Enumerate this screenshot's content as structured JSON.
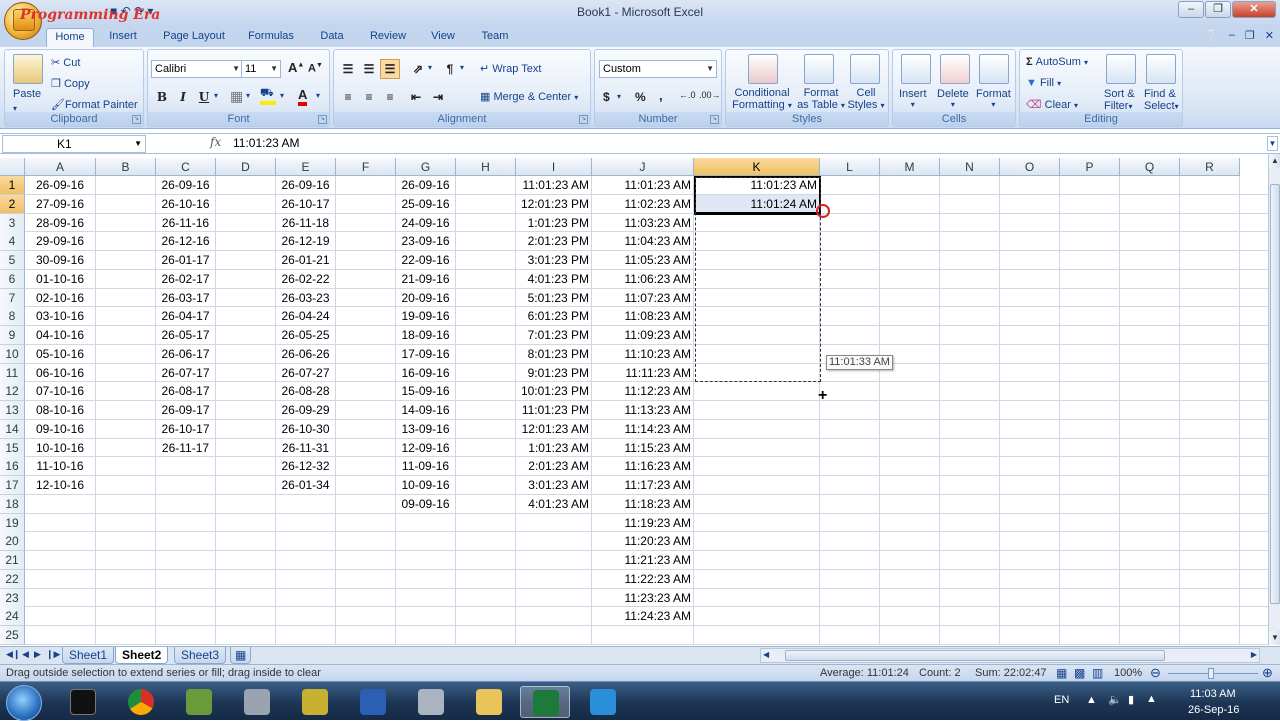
{
  "window": {
    "title": "Book1 - Microsoft Excel",
    "watermark": "Programming Era"
  },
  "tabs": [
    "Home",
    "Insert",
    "Page Layout",
    "Formulas",
    "Data",
    "Review",
    "View",
    "Team"
  ],
  "ribbon": {
    "clipboard": {
      "label": "Clipboard",
      "paste": "Paste",
      "cut": "Cut",
      "copy": "Copy",
      "format_painter": "Format Painter"
    },
    "font": {
      "label": "Font",
      "name": "Calibri",
      "size": "11"
    },
    "alignment": {
      "label": "Alignment",
      "wrap": "Wrap Text",
      "merge": "Merge & Center"
    },
    "number": {
      "label": "Number",
      "format": "Custom",
      "currency": "$",
      "percent": "%",
      "comma": ","
    },
    "styles": {
      "label": "Styles",
      "conditional": "Conditional",
      "conditional2": "Formatting",
      "format_table": "Format",
      "format_table2": "as Table",
      "cell_styles": "Cell",
      "cell_styles2": "Styles"
    },
    "cells": {
      "label": "Cells",
      "insert": "Insert",
      "delete": "Delete",
      "format": "Format"
    },
    "editing": {
      "label": "Editing",
      "autosum": "AutoSum",
      "fill": "Fill",
      "clear": "Clear",
      "sort": "Sort &",
      "sort2": "Filter",
      "find": "Find &",
      "find2": "Select"
    }
  },
  "formula_bar": {
    "name_box": "K1",
    "fx": "fx",
    "value": "11:01:23 AM"
  },
  "columns": [
    "A",
    "B",
    "C",
    "D",
    "E",
    "F",
    "G",
    "H",
    "I",
    "J",
    "K",
    "L",
    "M",
    "N",
    "O",
    "P",
    "Q",
    "R"
  ],
  "rows": [
    "1",
    "2",
    "3",
    "4",
    "5",
    "6",
    "7",
    "8",
    "9",
    "10",
    "11",
    "12",
    "13",
    "14",
    "15",
    "16",
    "17",
    "18",
    "19",
    "20",
    "21",
    "22",
    "23",
    "24",
    "25"
  ],
  "cells": {
    "A": [
      "26-09-16",
      "27-09-16",
      "28-09-16",
      "29-09-16",
      "30-09-16",
      "01-10-16",
      "02-10-16",
      "03-10-16",
      "04-10-16",
      "05-10-16",
      "06-10-16",
      "07-10-16",
      "08-10-16",
      "09-10-16",
      "10-10-16",
      "11-10-16",
      "12-10-16"
    ],
    "C": [
      "26-09-16",
      "26-10-16",
      "26-11-16",
      "26-12-16",
      "26-01-17",
      "26-02-17",
      "26-03-17",
      "26-04-17",
      "26-05-17",
      "26-06-17",
      "26-07-17",
      "26-08-17",
      "26-09-17",
      "26-10-17",
      "26-11-17"
    ],
    "E": [
      "26-09-16",
      "26-10-17",
      "26-11-18",
      "26-12-19",
      "26-01-21",
      "26-02-22",
      "26-03-23",
      "26-04-24",
      "26-05-25",
      "26-06-26",
      "26-07-27",
      "26-08-28",
      "26-09-29",
      "26-10-30",
      "26-11-31",
      "26-12-32",
      "26-01-34"
    ],
    "G": [
      "26-09-16",
      "25-09-16",
      "24-09-16",
      "23-09-16",
      "22-09-16",
      "21-09-16",
      "20-09-16",
      "19-09-16",
      "18-09-16",
      "17-09-16",
      "16-09-16",
      "15-09-16",
      "14-09-16",
      "13-09-16",
      "12-09-16",
      "11-09-16",
      "10-09-16",
      "09-09-16"
    ],
    "I": [
      "11:01:23 AM",
      "12:01:23 PM",
      "1:01:23 PM",
      "2:01:23 PM",
      "3:01:23 PM",
      "4:01:23 PM",
      "5:01:23 PM",
      "6:01:23 PM",
      "7:01:23 PM",
      "8:01:23 PM",
      "9:01:23 PM",
      "10:01:23 PM",
      "11:01:23 PM",
      "12:01:23 AM",
      "1:01:23 AM",
      "2:01:23 AM",
      "3:01:23 AM",
      "4:01:23 AM"
    ],
    "J": [
      "11:01:23 AM",
      "11:02:23 AM",
      "11:03:23 AM",
      "11:04:23 AM",
      "11:05:23 AM",
      "11:06:23 AM",
      "11:07:23 AM",
      "11:08:23 AM",
      "11:09:23 AM",
      "11:10:23 AM",
      "11:11:23 AM",
      "11:12:23 AM",
      "11:13:23 AM",
      "11:14:23 AM",
      "11:15:23 AM",
      "11:16:23 AM",
      "11:17:23 AM",
      "11:18:23 AM",
      "11:19:23 AM",
      "11:20:23 AM",
      "11:21:23 AM",
      "11:22:23 AM",
      "11:23:23 AM",
      "11:24:23 AM"
    ],
    "K": [
      "11:01:23 AM",
      "11:01:24 AM"
    ]
  },
  "fill_tooltip": "11:01:33 AM",
  "sheets": [
    "Sheet1",
    "Sheet2",
    "Sheet3"
  ],
  "active_sheet": "Sheet2",
  "status": {
    "message": "Drag outside selection to extend series or fill; drag inside to clear",
    "average": "Average: 11:01:24",
    "count": "Count: 2",
    "sum": "Sum: 22:02:47",
    "zoom": "100%"
  },
  "tray": {
    "lang": "EN",
    "time": "11:03 AM",
    "date": "26-Sep-16"
  },
  "colors": {
    "accent": "#15428b",
    "selected_header": "#f1c15f",
    "fill_circle": "#e02020"
  }
}
